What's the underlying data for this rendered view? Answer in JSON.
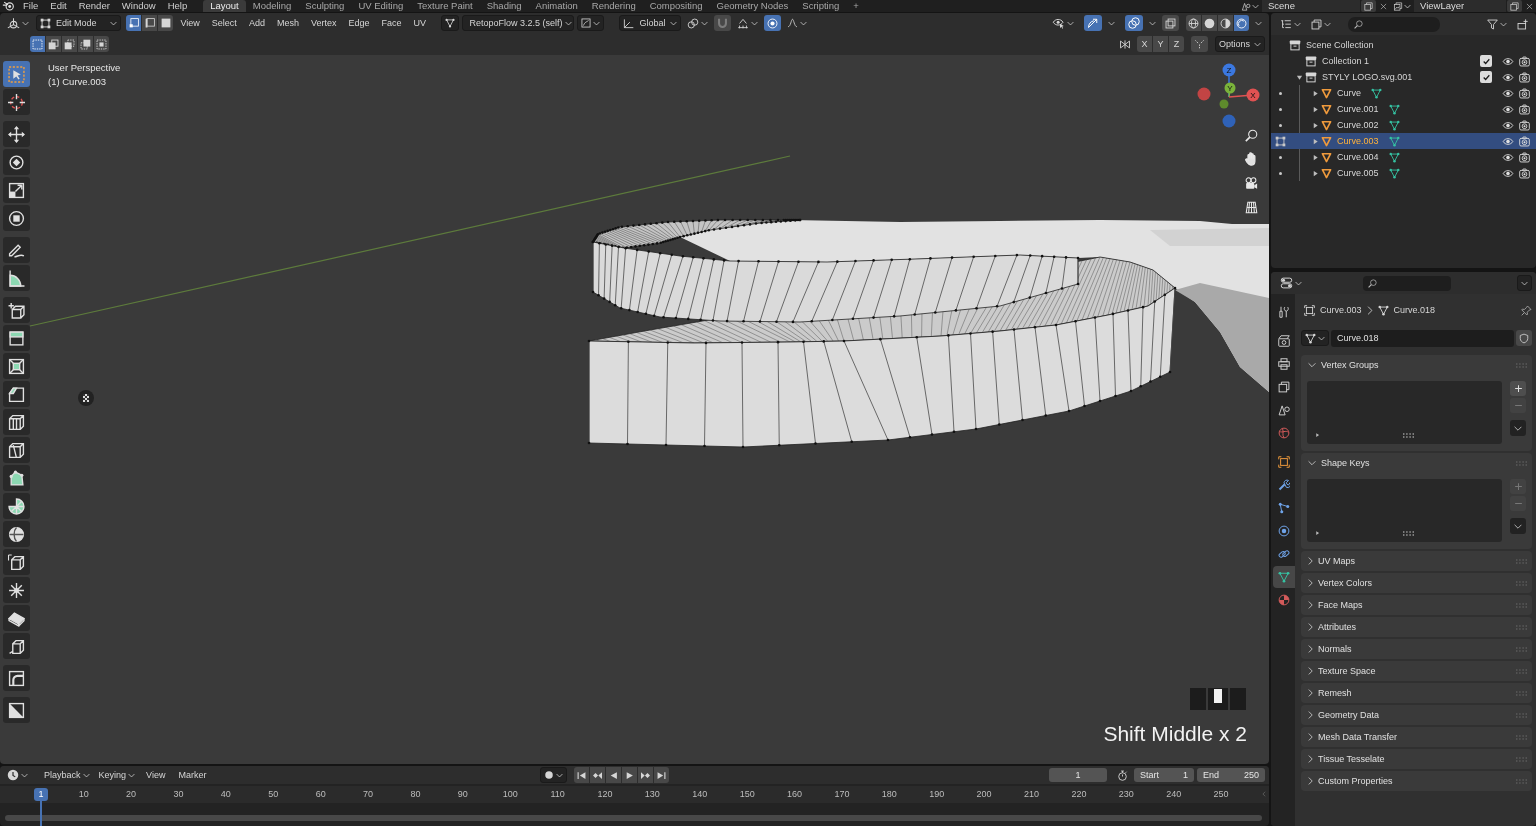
{
  "top_bar": {
    "menus": [
      "File",
      "Edit",
      "Render",
      "Window",
      "Help"
    ],
    "workspaces": [
      {
        "label": "Layout",
        "selected": true
      },
      {
        "label": "Modeling",
        "selected": false
      },
      {
        "label": "Sculpting",
        "selected": false
      },
      {
        "label": "UV Editing",
        "selected": false
      },
      {
        "label": "Texture Paint",
        "selected": false
      },
      {
        "label": "Shading",
        "selected": false
      },
      {
        "label": "Animation",
        "selected": false
      },
      {
        "label": "Rendering",
        "selected": false
      },
      {
        "label": "Compositing",
        "selected": false
      },
      {
        "label": "Geometry Nodes",
        "selected": false
      },
      {
        "label": "Scripting",
        "selected": false
      }
    ],
    "add_workspace": "+",
    "scene": "Scene",
    "view_layer": "ViewLayer"
  },
  "viewport_header": {
    "mode": "Edit Mode",
    "select_modes": [
      {
        "kind": "vertex",
        "selected": true
      },
      {
        "kind": "edge",
        "selected": false
      },
      {
        "kind": "face",
        "selected": false
      }
    ],
    "menus": [
      "View",
      "Select",
      "Add",
      "Mesh",
      "Vertex",
      "Edge",
      "Face",
      "UV"
    ],
    "addon": "RetopoFlow 3.2.5 (self)",
    "orientation": "Global",
    "snap": false,
    "proportional_editing": true,
    "gizmos": true,
    "overlays": true,
    "xray": false,
    "shading": [
      {
        "kind": "wireframe",
        "selected": false
      },
      {
        "kind": "solid",
        "selected": false
      },
      {
        "kind": "material_preview",
        "selected": false
      },
      {
        "kind": "rendered",
        "selected": true
      }
    ]
  },
  "tool_header": {
    "selection_modes": [
      {
        "kind": "set",
        "selected": true
      },
      {
        "kind": "extend",
        "selected": false
      },
      {
        "kind": "subtract",
        "selected": false
      },
      {
        "kind": "invert",
        "selected": false
      },
      {
        "kind": "intersect",
        "selected": false
      }
    ],
    "mirror_axes": [
      {
        "label": "X",
        "on": false
      },
      {
        "label": "Y",
        "on": false
      },
      {
        "label": "Z",
        "on": false
      }
    ],
    "options": "Options"
  },
  "viewport": {
    "info": [
      "User Perspective",
      "(1) Curve.003"
    ],
    "tools": [
      {
        "kind": "select_box",
        "selected": true
      },
      {
        "kind": "cursor",
        "selected": false
      },
      {
        "kind": "move",
        "selected": false
      },
      {
        "kind": "rotate",
        "selected": false
      },
      {
        "kind": "scale",
        "selected": false
      },
      {
        "kind": "transform",
        "selected": false
      },
      {
        "kind": "annotate",
        "selected": false
      },
      {
        "kind": "measure",
        "selected": false
      },
      {
        "kind": "add_cube",
        "selected": false
      },
      {
        "kind": "extrude",
        "selected": false
      },
      {
        "kind": "inset",
        "selected": false
      },
      {
        "kind": "bevel",
        "selected": false
      },
      {
        "kind": "loop_cut",
        "selected": false
      },
      {
        "kind": "knife",
        "selected": false
      },
      {
        "kind": "poly_build",
        "selected": false
      },
      {
        "kind": "spin",
        "selected": false
      },
      {
        "kind": "smooth",
        "selected": false
      },
      {
        "kind": "edge_slide",
        "selected": false
      },
      {
        "kind": "shrink_fatten",
        "selected": false
      },
      {
        "kind": "shear",
        "selected": false
      },
      {
        "kind": "rip",
        "selected": false
      },
      {
        "kind": "arc_corner",
        "selected": false
      },
      {
        "kind": "diagonal_box",
        "selected": false
      }
    ],
    "gizmo_axes": [
      {
        "label": "Z",
        "color": "#3b78e0"
      },
      {
        "label": "Y",
        "color": "#7ab33a"
      },
      {
        "label": "X",
        "color": "#e05252"
      },
      {
        "color": "#c24444"
      },
      {
        "color": "#5e8a2c"
      },
      {
        "color": "#2f62b8"
      }
    ],
    "key_hint": "Shift Middle x 2"
  },
  "outliner": {
    "tree": [
      {
        "name": "Scene Collection",
        "kind": "scene_collection",
        "selected": false,
        "children": [
          {
            "name": "Collection 1",
            "kind": "collection",
            "selected": false,
            "checked": true,
            "expanded": false
          },
          {
            "name": "STYLY LOGO.svg.001",
            "kind": "collection",
            "selected": false,
            "checked": true,
            "expanded": true,
            "children": [
              {
                "name": "Curve",
                "kind": "object",
                "selected": false,
                "expanded": false,
                "editing": false
              },
              {
                "name": "Curve.001",
                "kind": "object",
                "selected": false,
                "expanded": false,
                "editing": false
              },
              {
                "name": "Curve.002",
                "kind": "object",
                "selected": false,
                "expanded": false,
                "editing": false
              },
              {
                "name": "Curve.003",
                "kind": "object",
                "selected": true,
                "expanded": false,
                "editing": true
              },
              {
                "name": "Curve.004",
                "kind": "object",
                "selected": false,
                "expanded": false,
                "editing": false
              },
              {
                "name": "Curve.005",
                "kind": "object",
                "selected": false,
                "expanded": false,
                "editing": false
              }
            ]
          }
        ]
      }
    ]
  },
  "properties": {
    "tabs": [
      {
        "kind": "tool",
        "selected": false
      },
      {
        "kind": "render",
        "selected": false
      },
      {
        "kind": "output",
        "selected": false
      },
      {
        "kind": "view_layer",
        "selected": false
      },
      {
        "kind": "scene",
        "selected": false
      },
      {
        "kind": "world",
        "selected": false
      },
      {
        "kind": "object",
        "selected": false
      },
      {
        "kind": "modifiers",
        "selected": false
      },
      {
        "kind": "particles",
        "selected": false
      },
      {
        "kind": "physics",
        "selected": false
      },
      {
        "kind": "constraints",
        "selected": false
      },
      {
        "kind": "data",
        "selected": true
      },
      {
        "kind": "material",
        "selected": false
      }
    ],
    "breadcrumb": [
      {
        "kind": "object",
        "label": "Curve.003"
      },
      {
        "kind": "mesh",
        "label": "Curve.018"
      }
    ],
    "mesh_name": "Curve.018",
    "panels": [
      {
        "title": "Vertex Groups",
        "expanded": true,
        "list_box": {
          "add_disabled": false,
          "remove_disabled": true
        }
      },
      {
        "title": "Shape Keys",
        "expanded": true,
        "list_box": {
          "add_disabled": true,
          "remove_disabled": true
        }
      },
      {
        "title": "UV Maps",
        "expanded": false
      },
      {
        "title": "Vertex Colors",
        "expanded": false
      },
      {
        "title": "Face Maps",
        "expanded": false
      },
      {
        "title": "Attributes",
        "expanded": false
      },
      {
        "title": "Normals",
        "expanded": false
      },
      {
        "title": "Texture Space",
        "expanded": false
      },
      {
        "title": "Remesh",
        "expanded": false
      },
      {
        "title": "Geometry Data",
        "expanded": false
      },
      {
        "title": "Mesh Data Transfer",
        "expanded": false
      },
      {
        "title": "Tissue Tesselate",
        "expanded": false
      },
      {
        "title": "Custom Properties",
        "expanded": false
      }
    ]
  },
  "timeline": {
    "menus": [
      {
        "label": "Playback",
        "kind": "dropdown"
      },
      {
        "label": "Keying",
        "kind": "dropdown"
      },
      {
        "label": "View",
        "kind": "menu"
      },
      {
        "label": "Marker",
        "kind": "menu"
      }
    ],
    "current_frame": "1",
    "start_label": "Start",
    "start": "1",
    "end_label": "End",
    "end": "250",
    "ruler": [
      {
        "label": "1",
        "selected": true
      },
      {
        "label": "10",
        "selected": false
      },
      {
        "label": "20",
        "selected": false
      },
      {
        "label": "30",
        "selected": false
      },
      {
        "label": "40",
        "selected": false
      },
      {
        "label": "50",
        "selected": false
      },
      {
        "label": "60",
        "selected": false
      },
      {
        "label": "70",
        "selected": false
      },
      {
        "label": "80",
        "selected": false
      },
      {
        "label": "90",
        "selected": false
      },
      {
        "label": "100",
        "selected": false
      },
      {
        "label": "110",
        "selected": false
      },
      {
        "label": "120",
        "selected": false
      },
      {
        "label": "130",
        "selected": false
      },
      {
        "label": "140",
        "selected": false
      },
      {
        "label": "150",
        "selected": false
      },
      {
        "label": "160",
        "selected": false
      },
      {
        "label": "170",
        "selected": false
      },
      {
        "label": "180",
        "selected": false
      },
      {
        "label": "190",
        "selected": false
      },
      {
        "label": "200",
        "selected": false
      },
      {
        "label": "210",
        "selected": false
      },
      {
        "label": "220",
        "selected": false
      },
      {
        "label": "230",
        "selected": false
      },
      {
        "label": "240",
        "selected": false
      },
      {
        "label": "250",
        "selected": false
      }
    ]
  }
}
